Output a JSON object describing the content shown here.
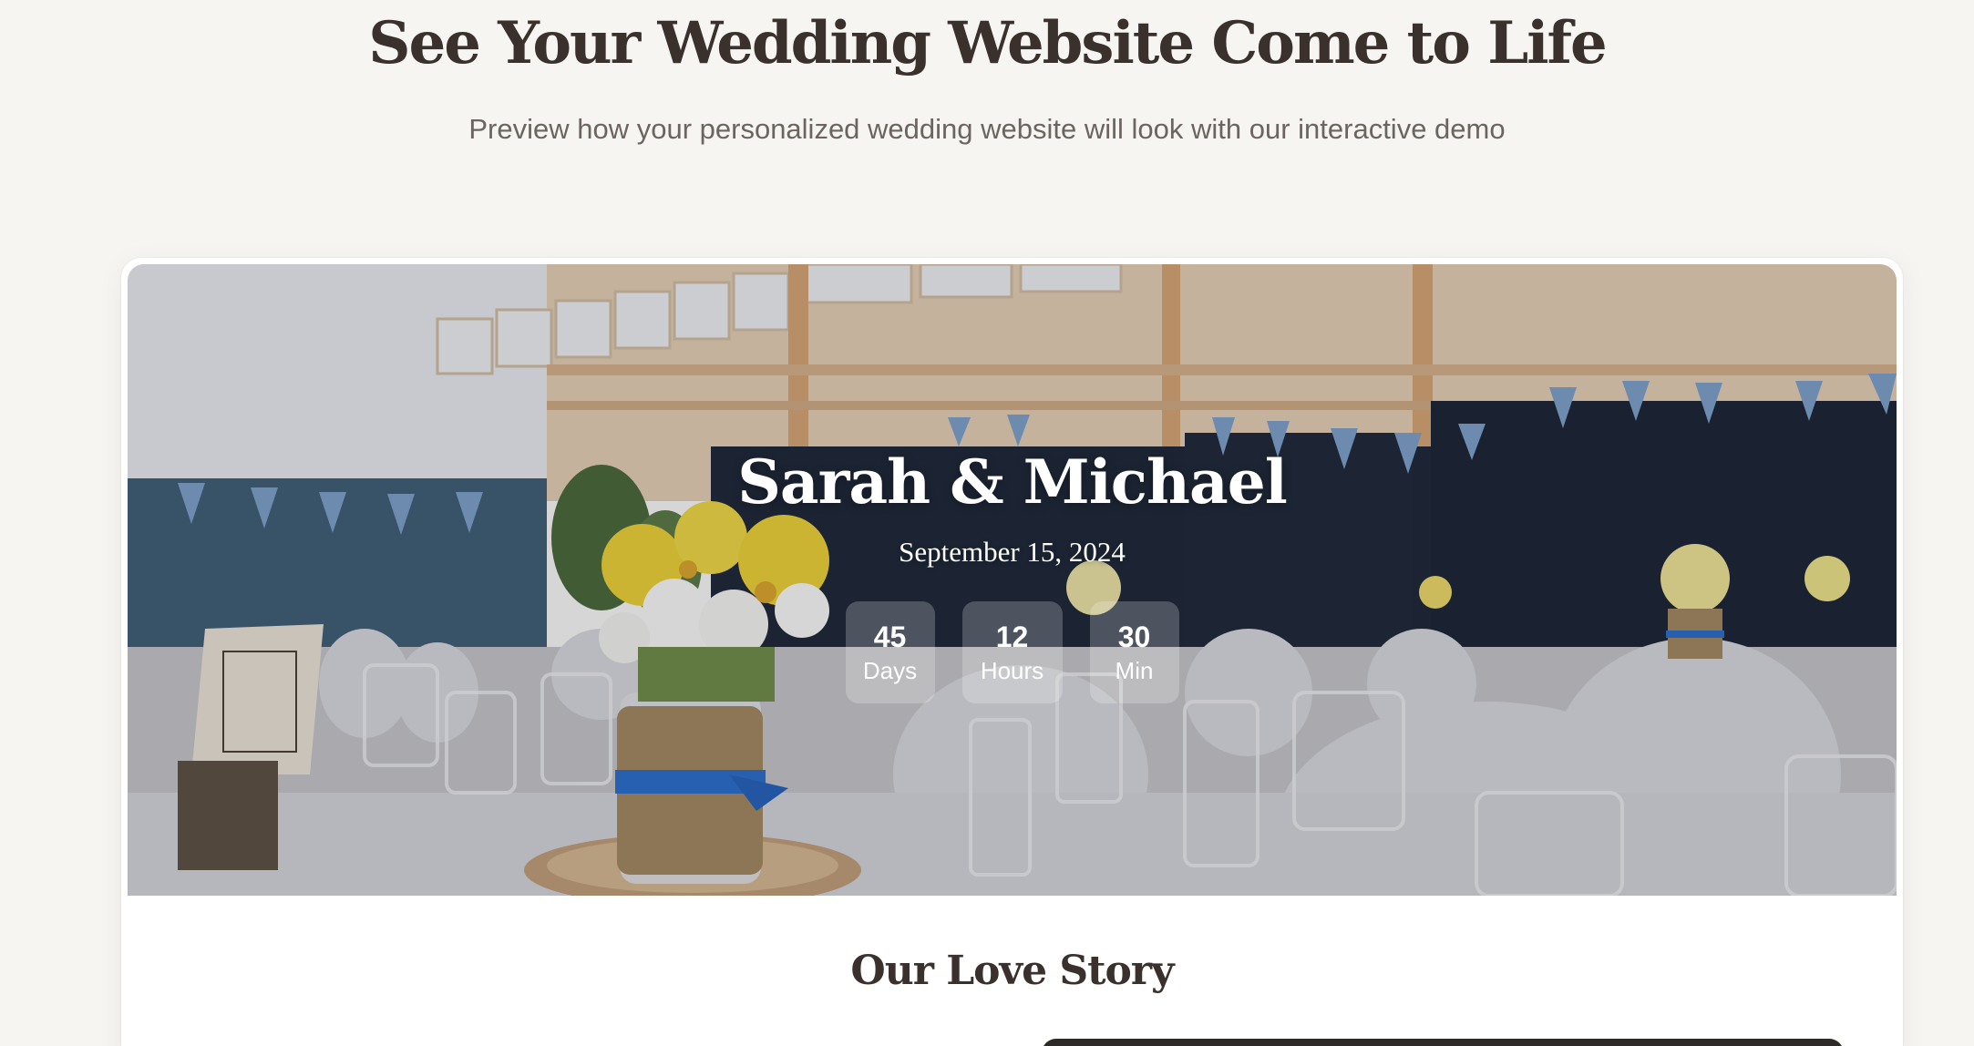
{
  "heading": {
    "title": "See Your Wedding Website Come to Life",
    "subtitle": "Preview how your personalized wedding website will look with our interactive demo"
  },
  "demo": {
    "couple_names": "Sarah & Michael",
    "wedding_date": "September 15, 2024",
    "countdown": [
      {
        "value": "45",
        "label": "Days"
      },
      {
        "value": "12",
        "label": "Hours"
      },
      {
        "value": "30",
        "label": "Min"
      }
    ],
    "story_title": "Our Love Story"
  },
  "colors": {
    "page_background": "#f6f5f2",
    "heading_text": "#3a302c",
    "subtitle_text": "#6c6460",
    "card_background": "#ffffff",
    "ribbon_blue": "#2a6fd1",
    "flower_yellow": "#f2d635"
  }
}
